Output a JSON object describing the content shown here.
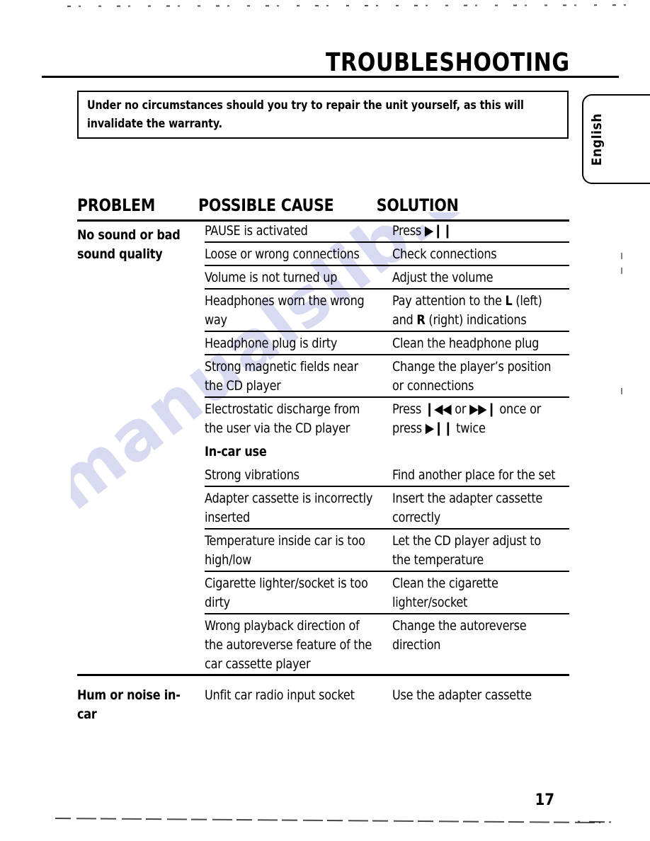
{
  "page": {
    "title": "TROUBLESHOOTING",
    "number": "17",
    "language_tab": "English",
    "watermark": "manualslib.com"
  },
  "warning": {
    "text": "Under no circumstances should you try to repair the unit yourself, as this will invalidate the warranty."
  },
  "table": {
    "headers": {
      "problem": "PROBLEM",
      "cause": "POSSIBLE CAUSE",
      "solution": "SOLUTION"
    },
    "sections": [
      {
        "problem": "No sound or bad sound quality",
        "rows": [
          {
            "cause": "PAUSE is activated",
            "solution": "Press ▶❙❙"
          },
          {
            "cause": "Loose or wrong connections",
            "solution": "Check connections"
          },
          {
            "cause": "Volume is not turned up",
            "solution": "Adjust the volume"
          },
          {
            "cause": "Headphones worn the wrong way",
            "solution": "Pay attention to the L (left) and R (right) indications"
          },
          {
            "cause": "Headphone plug is dirty",
            "solution": "Clean the headphone plug"
          },
          {
            "cause": "Strong magnetic fields near the CD player",
            "solution": "Change the player’s position or connections"
          },
          {
            "cause": "Electrostatic discharge from the user via the CD player",
            "solution": "Press ❙◀◀ or ▶▶❙ once or press ▶❙❙ twice",
            "rule": "none"
          },
          {
            "cause": "In-car use",
            "solution": "",
            "subheading": true,
            "rule": "none"
          },
          {
            "cause": "Strong vibrations",
            "solution": "Find another place for the set"
          },
          {
            "cause": "Adapter cassette is incorrectly inserted",
            "solution": "Insert the adapter cassette correctly"
          },
          {
            "cause": "Temperature inside car is too high/low",
            "solution": "Let the CD player adjust to the temperature"
          },
          {
            "cause": "Cigarette lighter/socket is too dirty",
            "solution": "Clean the cigarette lighter/socket"
          },
          {
            "cause": "Wrong playback direction of the autoreverse feature of the car cassette player",
            "solution": "Change the autoreverse direction",
            "rule": "full"
          }
        ]
      },
      {
        "problem": "Hum or noise in-car",
        "rows": [
          {
            "cause": "Unfit car radio input socket",
            "solution": "Use the adapter cassette",
            "rule": "none"
          }
        ]
      }
    ]
  }
}
